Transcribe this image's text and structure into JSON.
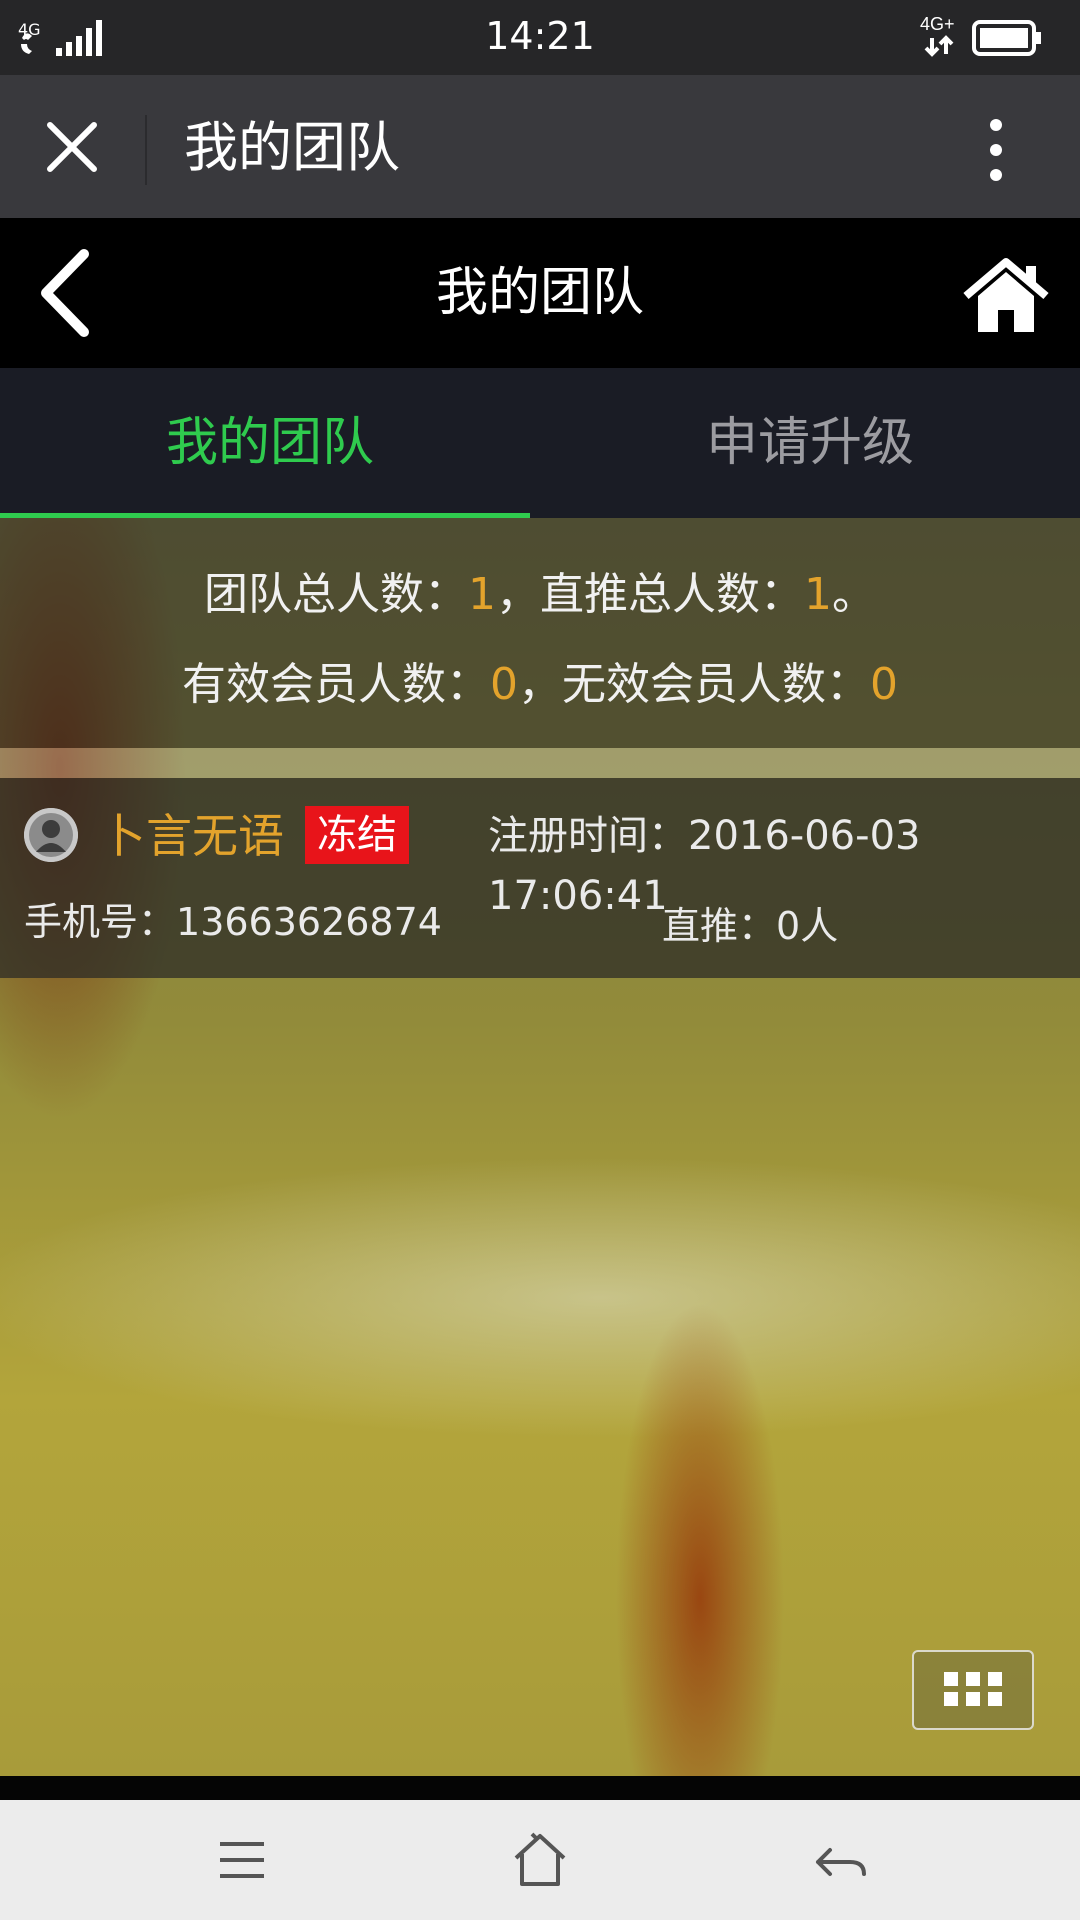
{
  "status_bar": {
    "time": "14:21",
    "network_left": "4G",
    "network_right": "4G+"
  },
  "wechat_bar": {
    "title": "我的团队",
    "icons": [
      "close-icon",
      "more-vertical-icon"
    ]
  },
  "header": {
    "title": "我的团队",
    "icons": [
      "back-arrow-icon",
      "home-icon"
    ]
  },
  "tabs": [
    {
      "label": "我的团队",
      "active": true
    },
    {
      "label": "申请升级",
      "active": false
    }
  ],
  "summary": {
    "team_total_label": "团队总人数：",
    "team_total_value": "1",
    "direct_total_label": "，直推总人数：",
    "direct_total_value": "1",
    "direct_total_suffix": "。",
    "valid_label": "有效会员人数：",
    "valid_value": "0",
    "invalid_label": "，无效会员人数：",
    "invalid_value": "0"
  },
  "member": {
    "name": "卜言无语",
    "status_badge": "冻结",
    "reg_time_label": "注册时间：",
    "reg_time": "2016-06-03 17:06:41",
    "phone_label": "手机号：",
    "phone": "13663626874",
    "direct_label": "直推：",
    "direct_value": "0人"
  },
  "colors": {
    "accent_green": "#2fcb4e",
    "highlight_orange": "#e3a32c",
    "badge_red": "#e8141a"
  }
}
